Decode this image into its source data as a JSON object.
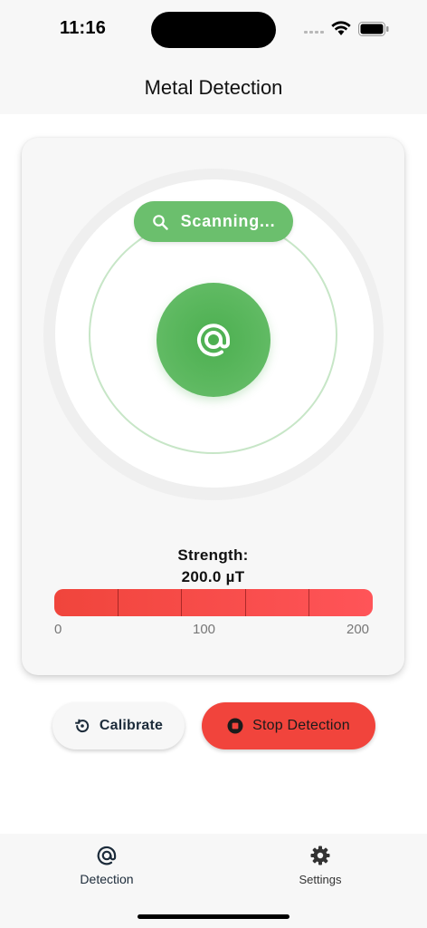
{
  "status_bar": {
    "time": "11:16"
  },
  "header": {
    "title": "Metal Detection"
  },
  "scanner": {
    "status_label": "Scanning...",
    "status_icon": "search-icon",
    "core_icon": "at-sign-icon"
  },
  "strength": {
    "label": "Strength:",
    "value_text": "200.0 µT",
    "fraction": 1.0,
    "scale_labels": [
      "0",
      "100",
      "200"
    ]
  },
  "actions": {
    "calibrate_label": "Calibrate",
    "stop_label": "Stop Detection"
  },
  "nav": {
    "items": [
      {
        "label": "Detection",
        "icon": "detection-icon",
        "active": true
      },
      {
        "label": "Settings",
        "icon": "gear-icon",
        "active": false
      }
    ]
  },
  "colors": {
    "accent_green": "#4caf50",
    "danger_red": "#f1443c",
    "card_bg": "#f7f7f7"
  }
}
